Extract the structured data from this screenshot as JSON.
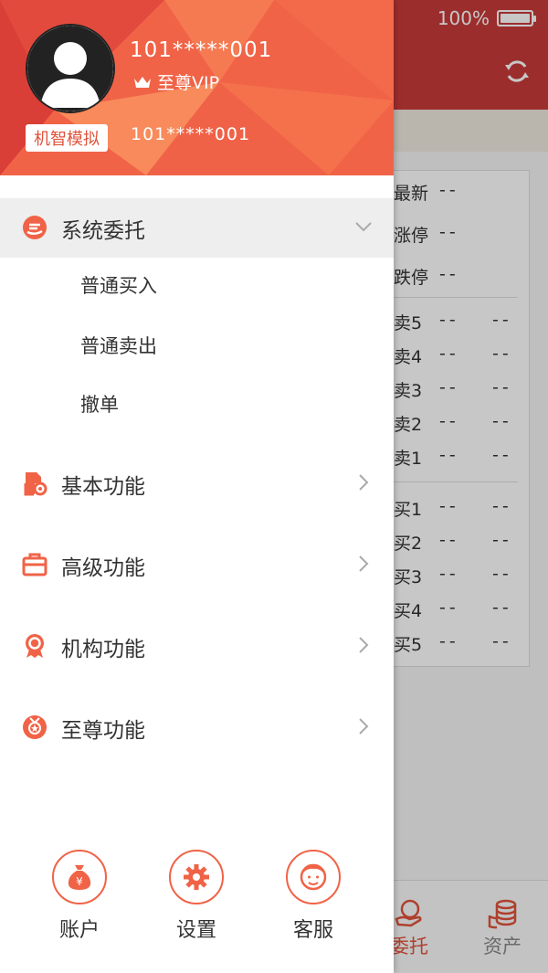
{
  "status_bar": {
    "battery": "100%"
  },
  "quote_panel": {
    "rows": [
      {
        "label": "最新",
        "v1": "--"
      },
      {
        "label": "涨停",
        "v1": "--"
      },
      {
        "label": "跌停",
        "v1": "--"
      },
      {
        "label": "卖5",
        "v1": "--",
        "v2": "--"
      },
      {
        "label": "卖4",
        "v1": "--",
        "v2": "--"
      },
      {
        "label": "卖3",
        "v1": "--",
        "v2": "--"
      },
      {
        "label": "卖2",
        "v1": "--",
        "v2": "--"
      },
      {
        "label": "卖1",
        "v1": "--",
        "v2": "--"
      },
      {
        "label": "买1",
        "v1": "--",
        "v2": "--"
      },
      {
        "label": "买2",
        "v1": "--",
        "v2": "--"
      },
      {
        "label": "买3",
        "v1": "--",
        "v2": "--"
      },
      {
        "label": "买4",
        "v1": "--",
        "v2": "--"
      },
      {
        "label": "买5",
        "v1": "--",
        "v2": "--"
      }
    ]
  },
  "tab_bar": {
    "tabs": [
      {
        "label": "委托",
        "icon": "hand-coin-icon"
      },
      {
        "label": "资产",
        "icon": "coin-stack-icon"
      }
    ]
  },
  "drawer": {
    "user_id": "101*****001",
    "vip_label": "至尊VIP",
    "mode_badge": "机智模拟",
    "account_number": "101*****001",
    "menu": {
      "system_order": {
        "label": "系统委托",
        "icon": "hand-order-icon",
        "sub_items": [
          "普通买入",
          "普通卖出",
          "撤单"
        ]
      },
      "basic": {
        "label": "基本功能",
        "icon": "document-gear-icon"
      },
      "advanced": {
        "label": "高级功能",
        "icon": "briefcase-icon"
      },
      "institution": {
        "label": "机构功能",
        "icon": "medal-icon"
      },
      "supreme": {
        "label": "至尊功能",
        "icon": "star-medal-icon"
      }
    },
    "bottom_buttons": [
      {
        "label": "账户",
        "icon": "money-bag-icon"
      },
      {
        "label": "设置",
        "icon": "gear-icon"
      },
      {
        "label": "客服",
        "icon": "support-agent-icon"
      }
    ]
  },
  "colors": {
    "accent": "#f06347",
    "header_red": "#c83a3a"
  }
}
